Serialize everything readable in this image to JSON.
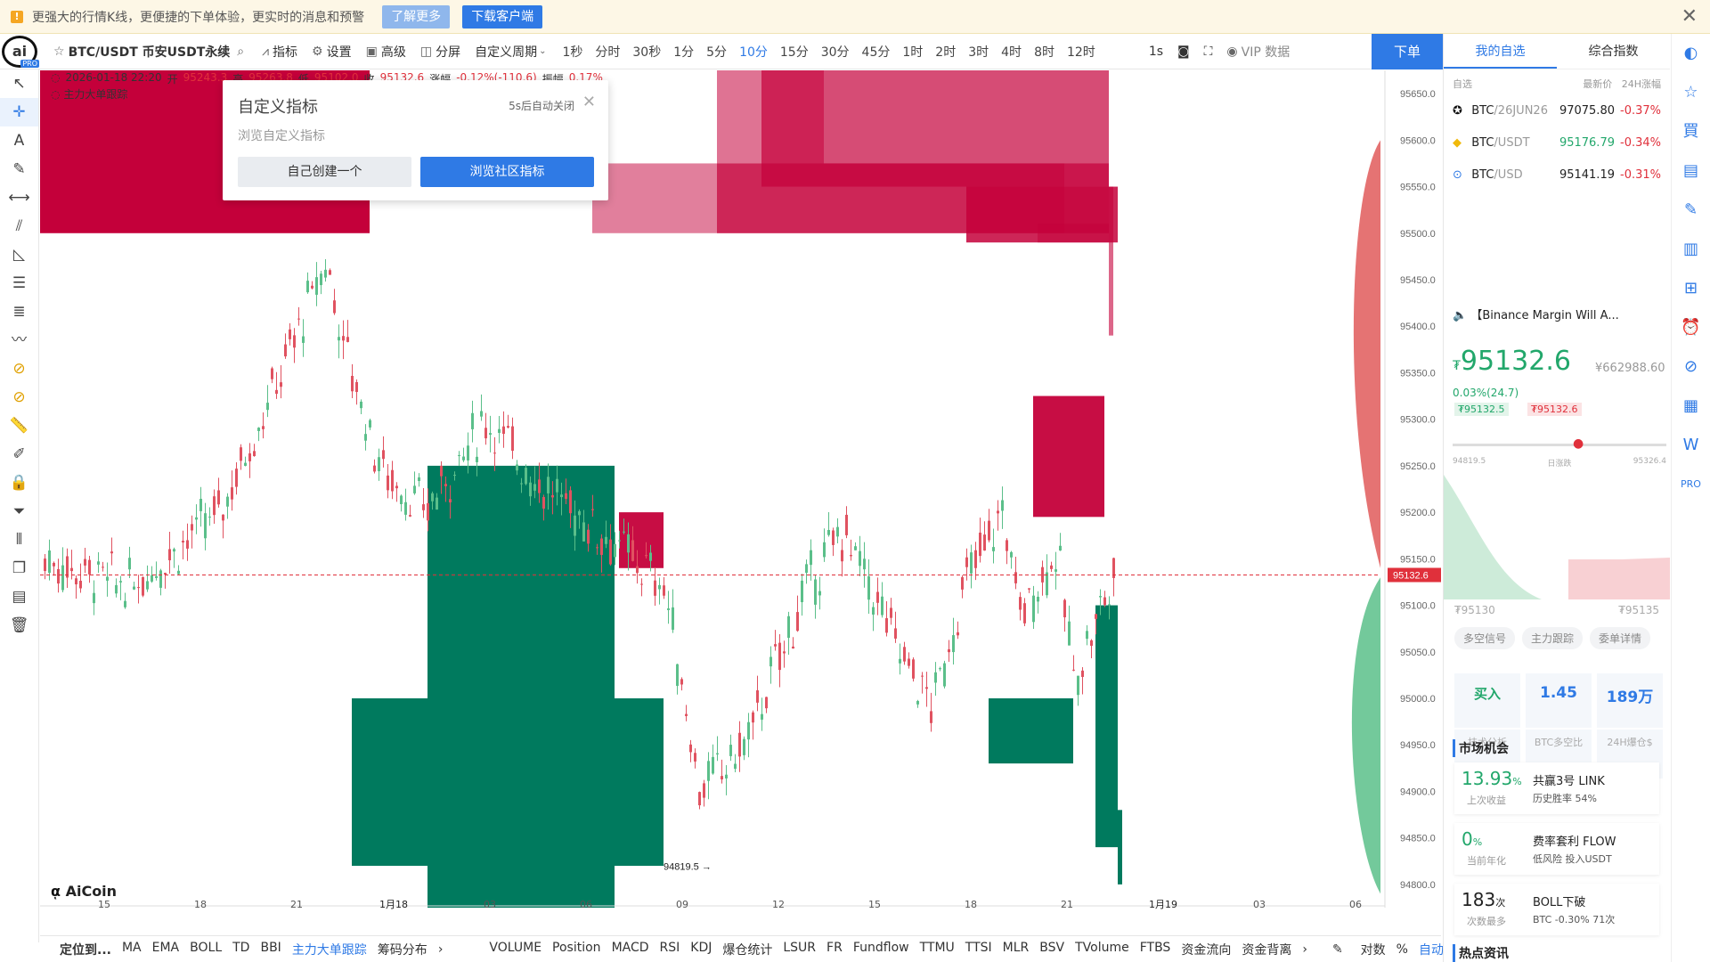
{
  "banner": {
    "text": "更强大的行情K线，更便捷的下单体验，更实时的消息和预警",
    "learn_more": "了解更多",
    "download": "下载客户端"
  },
  "toolbar": {
    "symbol": "BTC/USDT 币安USDT永续",
    "indicator": "指标",
    "settings": "设置",
    "advanced": "高级",
    "split": "分屏",
    "custom_period": "自定义周期",
    "periods": [
      "1秒",
      "分时",
      "30秒",
      "1分",
      "5分",
      "10分",
      "15分",
      "30分",
      "45分",
      "1时",
      "2时",
      "3时",
      "4时",
      "8时",
      "12时"
    ],
    "active_period": "10分",
    "interval": "1s",
    "vip": "VIP 数据",
    "order": "下单"
  },
  "info": {
    "datetime": "2026-01-18 22:20",
    "open_label": "开",
    "open": "95243.3",
    "high_label": "高",
    "high": "95263.8",
    "low_label": "低",
    "low": "95102.0",
    "close_label": "收",
    "close": "95132.6",
    "chg_label": "涨幅",
    "chg": "-0.12%(-110.6)",
    "amp_label": "振幅",
    "amp": "0.17%",
    "tracker": "主力大单跟踪"
  },
  "popup": {
    "title": "自定义指标",
    "desc": "浏览自定义指标",
    "auto_close": "5s后自动关闭",
    "create": "自己创建一个",
    "browse": "浏览社区指标"
  },
  "chart_data": {
    "type": "candlestick",
    "y_ticks": [
      "95650.0",
      "95600.0",
      "95550.0",
      "95500.0",
      "95450.0",
      "95400.0",
      "95350.0",
      "95300.0",
      "95250.0",
      "95200.0",
      "95150.0",
      "95100.0",
      "95050.0",
      "95000.0",
      "94950.0",
      "94900.0",
      "94850.0",
      "94800.0"
    ],
    "ylim": [
      94775,
      95675
    ],
    "x_ticks": [
      "15",
      "18",
      "21",
      "1月18",
      "03",
      "06",
      "09",
      "12",
      "15",
      "18",
      "21",
      "1月19",
      "03",
      "06"
    ],
    "last_price": "95132.6",
    "low_marker": "94819.5",
    "watermark": "AiCoin",
    "colors": {
      "up": "#c4003a",
      "down": "#007a5e",
      "bull_candle": "#5bbf8a",
      "bear_candle": "#e05260"
    }
  },
  "bottom": {
    "locate": "定位到...",
    "items": [
      "MA",
      "EMA",
      "BOLL",
      "TD",
      "BBI",
      "主力大单跟踪",
      "筹码分布"
    ],
    "items2": [
      "VOLUME",
      "Position",
      "MACD",
      "RSI",
      "KDJ",
      "爆仓统计",
      "LSUR",
      "FR",
      "Fundflow",
      "TTMU",
      "TTSI",
      "MLR",
      "BSV",
      "TVolume",
      "FTBS",
      "资金流向",
      "资金背离"
    ],
    "log": "对数",
    "pct": "%",
    "auto": "自动"
  },
  "right": {
    "tabs": [
      "我的自选",
      "综合指数"
    ],
    "head": {
      "col1": "自选",
      "col2": "最新价",
      "col3": "24H涨幅"
    },
    "watch": [
      {
        "sym": "BTC",
        "quote": "/26JUN26",
        "price": "97075.80",
        "chg": "-0.37%",
        "pcolor": "#222"
      },
      {
        "sym": "BTC",
        "quote": "/USDT",
        "price": "95176.79",
        "chg": "-0.34%",
        "pcolor": "#22a76b"
      },
      {
        "sym": "BTC",
        "quote": "/USD",
        "price": "95141.19",
        "chg": "-0.31%",
        "pcolor": "#222"
      }
    ],
    "news": "【Binance Margin Will A...",
    "price": "95132.6",
    "price_prefix": "₮",
    "cny": "¥662988.60",
    "chg": "0.03%(24.7)",
    "tag_low": "₮95132.5",
    "tag_high": "₮95132.6",
    "range_low": "94819.5",
    "range_label": "日涨跌",
    "range_high": "95326.4",
    "mini_left": "₮95130",
    "mini_right": "₮95135",
    "pills": [
      "多空信号",
      "主力跟踪",
      "委单详情"
    ],
    "stats": [
      {
        "v": "买入",
        "l": "技术分析"
      },
      {
        "v": "1.45",
        "l": "BTC多空比"
      },
      {
        "v": "189万",
        "l": "24H爆仓$"
      }
    ],
    "market": "市场机会",
    "cards": [
      {
        "n": "13.93",
        "u": "%",
        "s": "上次收益",
        "r1": "共赢3号 LINK",
        "r2": "历史胜率 54%"
      },
      {
        "n": "0",
        "u": "%",
        "s": "当前年化",
        "r1": "费率套利 FLOW",
        "r2": "低风险 投入USDT"
      },
      {
        "n": "183",
        "u": "次",
        "s": "次数最多",
        "r1": "BOLL下破",
        "r2": "BTC -0.30% 71次"
      }
    ],
    "hot": "热点资讯"
  }
}
